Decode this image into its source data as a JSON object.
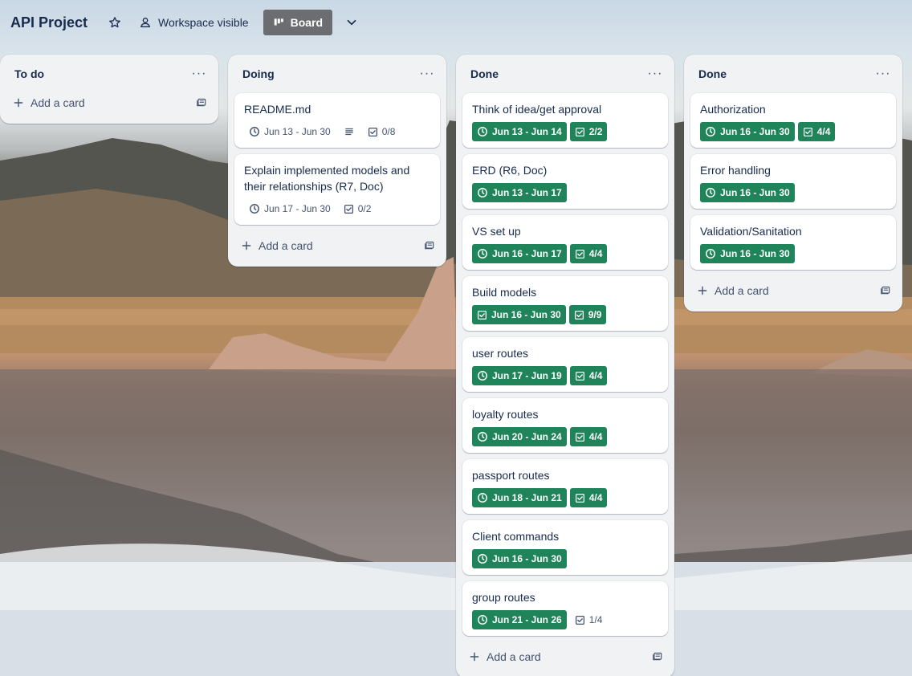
{
  "board": {
    "title": "API Project",
    "visibility_label": "Workspace visible",
    "view_label": "Board"
  },
  "colors": {
    "label_green": "#1f845a",
    "list_bg": "#f1f2f4",
    "text": "#172b4d"
  },
  "add_card_label": "Add a card",
  "lists": [
    {
      "title": "To do",
      "cards": []
    },
    {
      "title": "Doing",
      "cards": [
        {
          "title": "README.md",
          "dates": "Jun 13 - Jun 30",
          "has_description": true,
          "checklist": "0/8",
          "complete": false
        },
        {
          "title": "Explain implemented models and their relationships (R7, Doc)",
          "dates": "Jun 17 - Jun 30",
          "checklist": "0/2",
          "complete": false
        }
      ]
    },
    {
      "title": "Done",
      "cards": [
        {
          "title": "Think of idea/get approval",
          "dates": "Jun 13 - Jun 14",
          "checklist": "2/2",
          "complete": true
        },
        {
          "title": "ERD (R6, Doc)",
          "dates": "Jun 13 - Jun 17",
          "complete": true
        },
        {
          "title": "VS set up",
          "dates": "Jun 16 - Jun 17",
          "checklist": "4/4",
          "complete": true
        },
        {
          "title": "Build models",
          "dates": "Jun 16 - Jun 30",
          "checklist": "9/9",
          "complete": true,
          "date_icon": "check-box-icon"
        },
        {
          "title": "user routes",
          "dates": "Jun 17 - Jun 19",
          "checklist": "4/4",
          "complete": true
        },
        {
          "title": "loyalty routes",
          "dates": "Jun 20 - Jun 24",
          "checklist": "4/4",
          "complete": true
        },
        {
          "title": "passport routes",
          "dates": "Jun 18 - Jun 21",
          "checklist": "4/4",
          "complete": true
        },
        {
          "title": "Client commands",
          "dates": "Jun 16 - Jun 30",
          "complete": true
        },
        {
          "title": "group routes",
          "dates": "Jun 21 - Jun 26",
          "checklist": "1/4",
          "complete": true,
          "checklist_complete": false
        }
      ]
    },
    {
      "title": "Done",
      "cards": [
        {
          "title": "Authorization",
          "dates": "Jun 16 - Jun 30",
          "checklist": "4/4",
          "complete": true
        },
        {
          "title": "Error handling",
          "dates": "Jun 16 - Jun 30",
          "complete": true
        },
        {
          "title": "Validation/Sanitation",
          "dates": "Jun 16 - Jun 30",
          "complete": true
        }
      ]
    }
  ]
}
